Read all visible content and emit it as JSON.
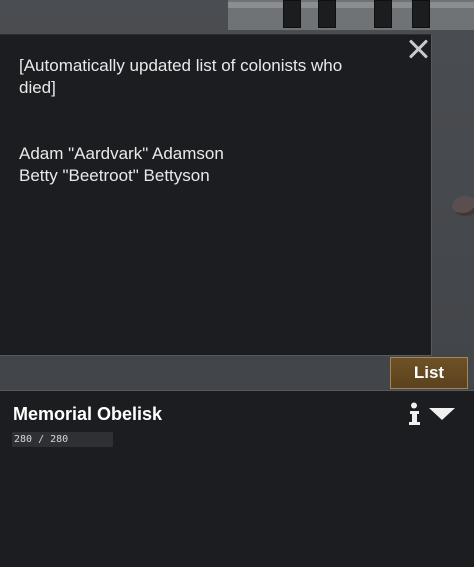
{
  "inscription": {
    "header": "[Automatically updated list of colonists who died]",
    "names": [
      "Adam \"Aardvark\" Adamson",
      "Betty \"Beetroot\" Bettyson"
    ]
  },
  "tab": {
    "label": "List"
  },
  "inspect": {
    "title": "Memorial Obelisk",
    "hp_text": "280 / 280",
    "hp_fraction": 1.0
  },
  "icons": {
    "close": "close-icon",
    "info": "info-icon",
    "dropdown": "chevron-down-icon"
  },
  "colors": {
    "panel_bg": "#1b1d21",
    "tab_bg": "#6e5126",
    "tab_border": "#a2875a"
  }
}
